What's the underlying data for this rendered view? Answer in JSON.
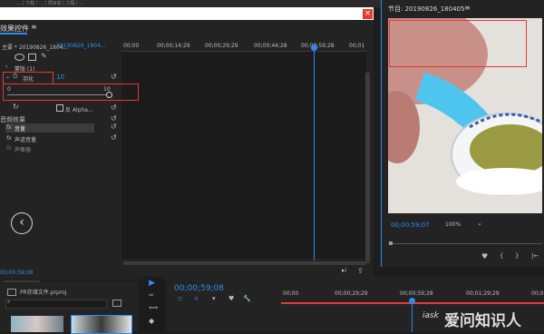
{
  "colors": {
    "accent": "#2d8ceb",
    "red_outline": "#e53935",
    "playhead": "#2d8ceb"
  },
  "window": {
    "title_fragment": "… / 下载 / … / 项目名 / 工程 / …"
  },
  "effects_panel": {
    "title": "效果控件",
    "master_label": "主要 * 20190826_1804...",
    "clip_label": "20190826_1804...",
    "ruler": [
      "00;00",
      "00;00;14;29",
      "00;00;29;29",
      "00;00;44;28",
      "00;00;59;28",
      "00;01"
    ],
    "mask_label": "蒙版 (1)",
    "feather_label": "羽化",
    "feather_value": "10",
    "slider_min": "0",
    "slider_max": "10",
    "invert_label": "反 Alpha...",
    "audio_effects_header": "音频效果",
    "volume_label": "音量",
    "channel_volume_label": "声道音量",
    "panner_label": "声像器",
    "fx_label": "fx",
    "timecode": "00;00;59;08"
  },
  "program_panel": {
    "title": "节目: 20190826_180405",
    "timecode": "00;00;59;07",
    "zoom": "100%"
  },
  "project_panel": {
    "title": "PR存储文件.prproj"
  },
  "timeline_panel": {
    "timecode": "00;00;59;08",
    "ruler": [
      "00;00",
      "00;00;29;29",
      "00;00;59;28",
      "00;01;29;29",
      "00;0"
    ]
  },
  "watermark": {
    "text": "爱问知识人",
    "brand": "iask"
  }
}
